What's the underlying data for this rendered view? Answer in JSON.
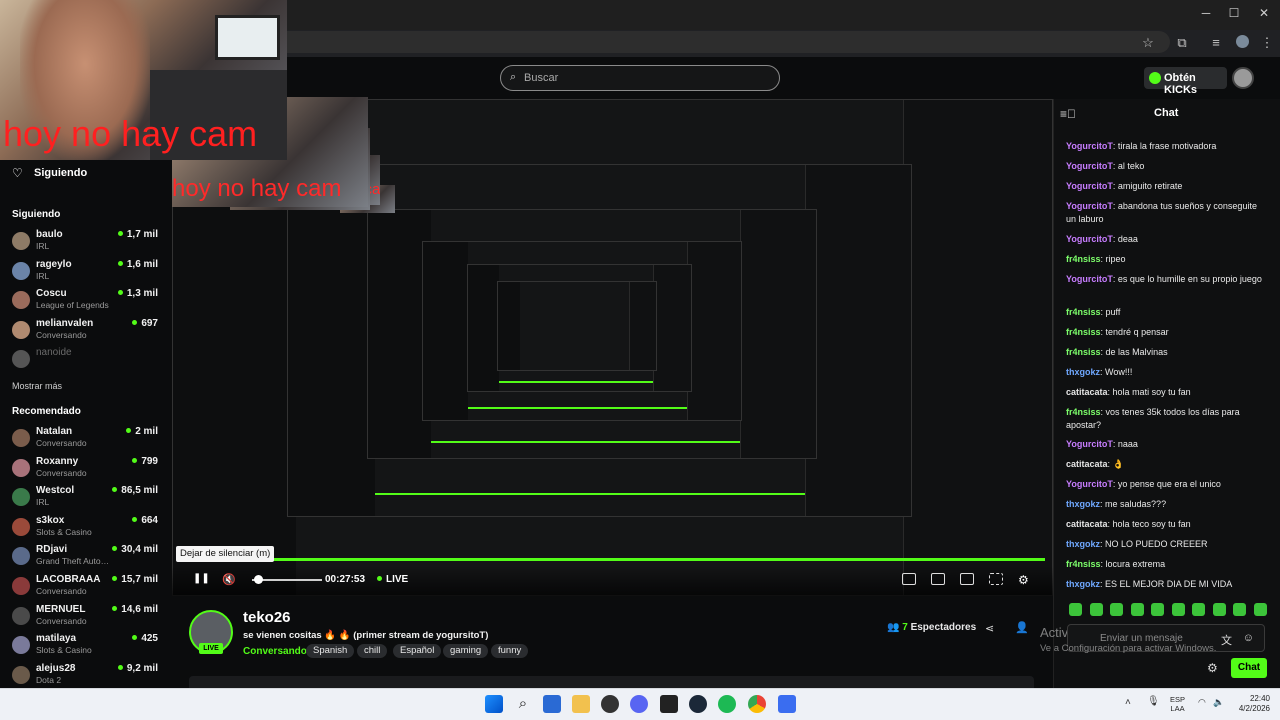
{
  "window": {
    "minimize": "─",
    "maximize": "☐",
    "close": "✕"
  },
  "browser": {
    "star_icon": "☆",
    "ext_icon": "⧉",
    "menu_icon": "⋮"
  },
  "header": {
    "search_placeholder": "Buscar",
    "kicks_label": "Obtén KICKs"
  },
  "webcam": {
    "overlay_text": "hoy no hay cam"
  },
  "sidebar": {
    "following_nav": "Siguiendo",
    "following_title": "Siguiendo",
    "following": [
      {
        "name": "baulo",
        "category": "IRL",
        "viewers": "1,7 mil"
      },
      {
        "name": "rageylo",
        "category": "IRL",
        "viewers": "1,6 mil"
      },
      {
        "name": "Coscu",
        "category": "League of Legends",
        "viewers": "1,3 mil"
      },
      {
        "name": "melianvalen",
        "category": "Conversando",
        "viewers": "697"
      },
      {
        "name": "nanoide",
        "category": "",
        "viewers": ""
      }
    ],
    "show_more": "Mostrar más",
    "recommended_title": "Recomendado",
    "recommended": [
      {
        "name": "Natalan",
        "category": "Conversando",
        "viewers": "2 mil"
      },
      {
        "name": "Roxanny",
        "category": "Conversando",
        "viewers": "799"
      },
      {
        "name": "Westcol",
        "category": "IRL",
        "viewers": "86,5 mil"
      },
      {
        "name": "s3kox",
        "category": "Slots & Casino",
        "viewers": "664"
      },
      {
        "name": "RDjavi",
        "category": "Grand Theft Auto…",
        "viewers": "30,4 mil"
      },
      {
        "name": "LACOBRAAA",
        "category": "Conversando",
        "viewers": "15,7 mil"
      },
      {
        "name": "MERNUEL",
        "category": "Conversando",
        "viewers": "14,6 mil"
      },
      {
        "name": "matilaya",
        "category": "Slots & Casino",
        "viewers": "425"
      },
      {
        "name": "alejus28",
        "category": "Dota 2",
        "viewers": "9,2 mil"
      }
    ]
  },
  "player": {
    "tooltip": "Dejar de silenciar (m)",
    "time": "00:27:53",
    "live": "LIVE",
    "play_icon": "❚❚",
    "volume_icon": "🔇",
    "settings_icon": "⚙"
  },
  "stream": {
    "channel": "teko26",
    "live_tag": "LIVE",
    "title": "se vienen cositas 🔥 🔥 (primer stream de yogursitoT)",
    "category": "Conversando",
    "tags": [
      "Spanish",
      "chill",
      "Español",
      "gaming",
      "funny"
    ],
    "viewers_count": "7",
    "viewers_label": "Espectadores"
  },
  "chat": {
    "title": "Chat",
    "messages": [
      {
        "user": "YogurcitoT",
        "color": "#c77dff",
        "text": "tirala la frase motivadora"
      },
      {
        "user": "YogurcitoT",
        "color": "#c77dff",
        "text": "al teko"
      },
      {
        "user": "YogurcitoT",
        "color": "#c77dff",
        "text": "amiguito retirate"
      },
      {
        "user": "YogurcitoT",
        "color": "#c77dff",
        "text": "abandona tus sueños y conseguite un laburo"
      },
      {
        "user": "YogurcitoT",
        "color": "#c77dff",
        "text": "deaa"
      },
      {
        "user": "fr4nsiss",
        "color": "#7dff6b",
        "text": "ripeo"
      },
      {
        "user": "YogurcitoT",
        "color": "#c77dff",
        "text": "es que lo humille en su propio juego"
      },
      {
        "user": "fr4nsiss",
        "color": "#7dff6b",
        "text": "puff"
      },
      {
        "user": "fr4nsiss",
        "color": "#7dff6b",
        "text": "tendré q pensar"
      },
      {
        "user": "fr4nsiss",
        "color": "#7dff6b",
        "text": "de las Malvinas"
      },
      {
        "user": "thxgokz",
        "color": "#6fa8ff",
        "text": "Wow!!!"
      },
      {
        "user": "catitacata",
        "color": "#e6e6e6",
        "text": "hola mati soy tu fan"
      },
      {
        "user": "fr4nsiss",
        "color": "#7dff6b",
        "text": "vos tenes 35k todos los días para apostar?"
      },
      {
        "user": "YogurcitoT",
        "color": "#c77dff",
        "text": "naaa"
      },
      {
        "user": "catitacata",
        "color": "#e6e6e6",
        "text": "👌"
      },
      {
        "user": "YogurcitoT",
        "color": "#c77dff",
        "text": "yo pense que era el unico"
      },
      {
        "user": "thxgokz",
        "color": "#6fa8ff",
        "text": "me saludas???"
      },
      {
        "user": "catitacata",
        "color": "#e6e6e6",
        "text": "hola teco soy tu fan"
      },
      {
        "user": "thxgokz",
        "color": "#6fa8ff",
        "text": "NO LO PUEDO CREEER"
      },
      {
        "user": "fr4nsiss",
        "color": "#7dff6b",
        "text": "locura extrema"
      },
      {
        "user": "thxgokz",
        "color": "#6fa8ff",
        "text": "ES EL MEJOR DIA DE MI VIDA"
      }
    ],
    "input_placeholder": "Enviar un mensaje",
    "send_label": "Chat"
  },
  "watermark": {
    "line1": "Activar Windows",
    "line2": "Ve a Configuración para activar Windows."
  },
  "taskbar": {
    "lang_top": "ESP",
    "lang_bottom": "LAA",
    "time": "22:40",
    "date": "4/2/2026"
  },
  "colors": {
    "accent": "#53fc18",
    "background": "#0b0c0d"
  }
}
